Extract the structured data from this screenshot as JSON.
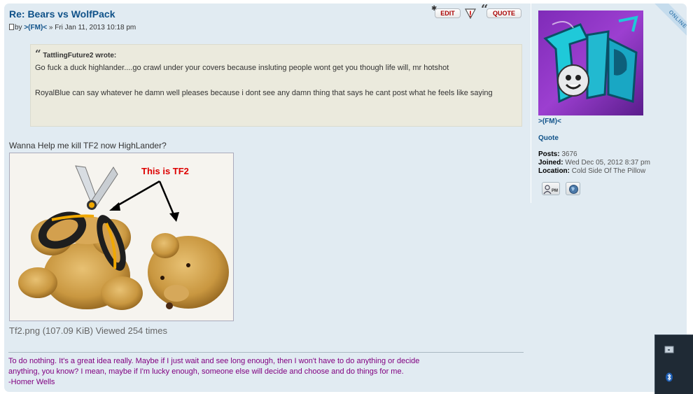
{
  "post": {
    "title": "Re: Bears vs WolfPack",
    "byline": {
      "prefix": "by",
      "author": ">(FM)<",
      "date": "» Fri Jan 11, 2013 10:18 pm"
    },
    "buttons": {
      "edit": "EDIT",
      "quote": "QUOTE"
    },
    "quote_block": {
      "author": "TattlingFuture2 wrote:",
      "paragraph1": "Go fuck a duck highlander....go crawl under your covers because insluting people wont get you though life will, mr hotshot",
      "paragraph2": "RoyalBlue can say whatever he damn well pleases because i dont see any damn thing that says he cant post what he feels like saying"
    },
    "text": "Wanna Help me kill TF2 now HighLander?",
    "attachment": {
      "image_label": "This is TF2",
      "caption": "Tf2.png (107.09 KiB) Viewed 254 times"
    },
    "signature": {
      "line1": "To do nothing. It's a great idea really. Maybe if I just wait and see long enough, then I won't have to do anything or decide",
      "line2": "anything, you know? I mean, maybe if I'm lucky enough, someone else will decide and choose and do things for me.",
      "line3": "-Homer Wells"
    }
  },
  "profile": {
    "status": "ONLINE",
    "username": ">(FM)<",
    "quote_link": "Quote",
    "stats": {
      "posts_label": "Posts:",
      "posts_value": "3676",
      "joined_label": "Joined:",
      "joined_value": "Wed Dec 05, 2012 8:37 pm",
      "location_label": "Location:",
      "location_value": "Cold Side Of The Pillow"
    },
    "pm_button": "PM"
  },
  "colors": {
    "post_bg": "#e1ebf2",
    "title": "#105289",
    "signature": "#800080",
    "quote_bg": "#ebeadd",
    "edit_red": "#aa0000"
  },
  "icons": [
    "document-icon",
    "star-icon",
    "warning-icon",
    "quote-mark-icon",
    "pm-icon",
    "website-icon",
    "monitor-icon",
    "bluetooth-icon"
  ]
}
